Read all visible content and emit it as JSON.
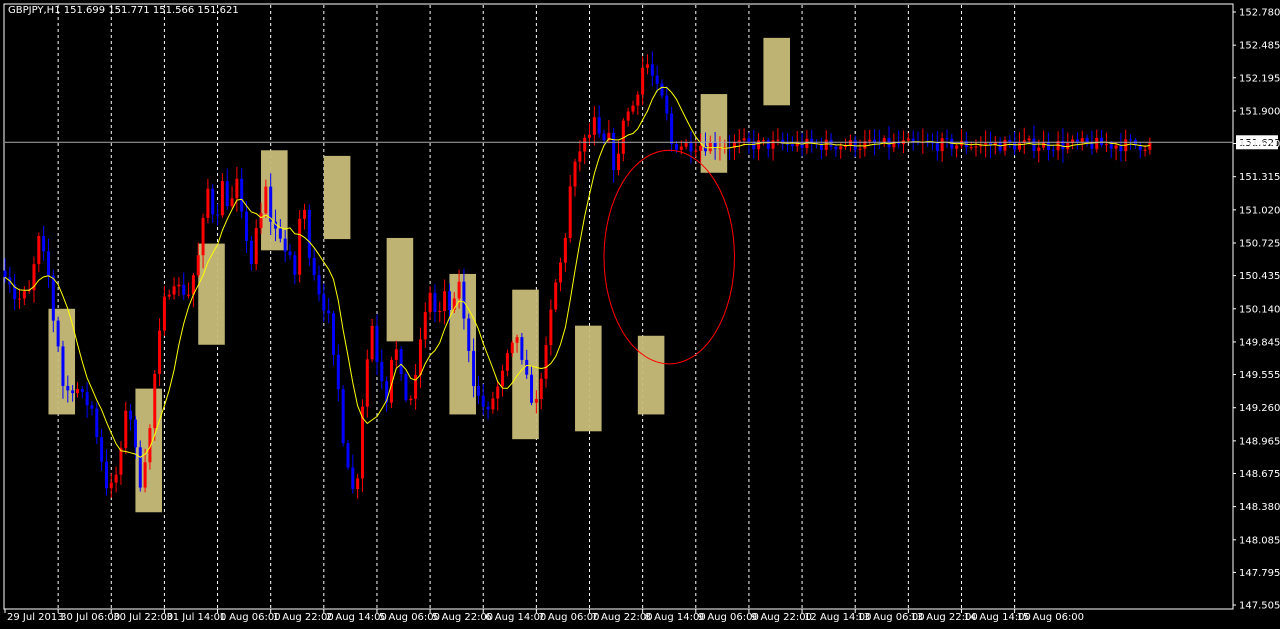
{
  "header": {
    "symbol": "GBPJPY,H1",
    "open": "151.699",
    "high": "151.771",
    "low": "151.566",
    "close": "151.621"
  },
  "colors": {
    "background": "#000000",
    "bull": "#ff0000",
    "bear": "#0000ff",
    "ma": "#ffff00",
    "box": "#c8bd78",
    "grid": "#ffffff",
    "circle": "#ff0000",
    "priceline": "#aaaaaa"
  },
  "chart_data": {
    "type": "candlestick",
    "ylim": [
      147.505,
      152.78
    ],
    "x_range": [
      0,
      508
    ],
    "y_ticks": [
      "152.780",
      "152.485",
      "152.195",
      "151.900",
      "151.610",
      "151.315",
      "151.020",
      "150.725",
      "150.435",
      "150.140",
      "149.845",
      "149.555",
      "149.260",
      "148.965",
      "148.675",
      "148.380",
      "148.085",
      "147.795",
      "147.505"
    ],
    "x_ticks": [
      {
        "label": "29 Jul 2013",
        "x": 0
      },
      {
        "label": "30 Jul 06:00",
        "x": 22
      },
      {
        "label": "30 Jul 22:00",
        "x": 44
      },
      {
        "label": "31 Jul 14:00",
        "x": 66
      },
      {
        "label": "1 Aug 06:00",
        "x": 88
      },
      {
        "label": "1 Aug 22:00",
        "x": 110
      },
      {
        "label": "2 Aug 14:00",
        "x": 132
      },
      {
        "label": "5 Aug 06:00",
        "x": 154
      },
      {
        "label": "5 Aug 22:00",
        "x": 176
      },
      {
        "label": "6 Aug 14:00",
        "x": 198
      },
      {
        "label": "7 Aug 06:00",
        "x": 220
      },
      {
        "label": "7 Aug 22:00",
        "x": 242
      },
      {
        "label": "8 Aug 14:00",
        "x": 264
      },
      {
        "label": "9 Aug 06:00",
        "x": 286
      },
      {
        "label": "9 Aug 22:00",
        "x": 308
      },
      {
        "label": "12 Aug 14:00",
        "x": 330
      },
      {
        "label": "13 Aug 06:00",
        "x": 352
      },
      {
        "label": "13 Aug 22:00",
        "x": 374
      },
      {
        "label": "14 Aug 14:00",
        "x": 396
      },
      {
        "label": "15 Aug 06:00",
        "x": 418
      }
    ],
    "current_price": "151.621",
    "anchors": [
      [
        0,
        150.48
      ],
      [
        5,
        150.22
      ],
      [
        10,
        150.28
      ],
      [
        14,
        150.75
      ],
      [
        17,
        150.55
      ],
      [
        20,
        150.05
      ],
      [
        25,
        149.4
      ],
      [
        29,
        149.45
      ],
      [
        32,
        149.35
      ],
      [
        36,
        149.25
      ],
      [
        40,
        148.8
      ],
      [
        43,
        148.5
      ],
      [
        45,
        148.6
      ],
      [
        48,
        148.85
      ],
      [
        51,
        149.4
      ],
      [
        53,
        148.95
      ],
      [
        56,
        148.6
      ],
      [
        59,
        148.9
      ],
      [
        62,
        149.55
      ],
      [
        64,
        149.9
      ],
      [
        67,
        150.3
      ],
      [
        70,
        150.4
      ],
      [
        73,
        150.3
      ],
      [
        76,
        150.28
      ],
      [
        80,
        150.6
      ],
      [
        84,
        151.2
      ],
      [
        87,
        150.95
      ],
      [
        90,
        151.25
      ],
      [
        93,
        151.05
      ],
      [
        96,
        151.25
      ],
      [
        99,
        150.85
      ],
      [
        102,
        150.55
      ],
      [
        105,
        150.9
      ],
      [
        108,
        151.2
      ],
      [
        111,
        150.85
      ],
      [
        114,
        150.8
      ],
      [
        117,
        150.6
      ],
      [
        120,
        150.45
      ],
      [
        123,
        151.1
      ],
      [
        126,
        150.65
      ],
      [
        130,
        150.3
      ],
      [
        134,
        150.05
      ],
      [
        137,
        149.55
      ],
      [
        140,
        149.0
      ],
      [
        143,
        148.7
      ],
      [
        145,
        148.35
      ],
      [
        147,
        149.0
      ],
      [
        149,
        149.6
      ],
      [
        152,
        150.0
      ],
      [
        155,
        149.6
      ],
      [
        158,
        149.35
      ],
      [
        161,
        149.85
      ],
      [
        164,
        149.5
      ],
      [
        167,
        149.3
      ],
      [
        170,
        149.5
      ],
      [
        173,
        150.0
      ],
      [
        176,
        150.3
      ],
      [
        179,
        150.05
      ],
      [
        182,
        150.25
      ],
      [
        185,
        150.1
      ],
      [
        188,
        150.4
      ],
      [
        191,
        149.9
      ],
      [
        194,
        149.5
      ],
      [
        197,
        149.3
      ],
      [
        200,
        149.2
      ],
      [
        203,
        149.4
      ],
      [
        206,
        149.55
      ],
      [
        209,
        149.75
      ],
      [
        212,
        149.9
      ],
      [
        215,
        149.55
      ],
      [
        218,
        149.35
      ],
      [
        220,
        149.3
      ],
      [
        223,
        149.65
      ],
      [
        226,
        150.1
      ],
      [
        229,
        150.45
      ],
      [
        232,
        150.8
      ],
      [
        235,
        151.35
      ],
      [
        238,
        151.55
      ],
      [
        241,
        151.65
      ],
      [
        244,
        151.8
      ],
      [
        247,
        151.6
      ],
      [
        250,
        151.65
      ],
      [
        253,
        151.35
      ],
      [
        256,
        151.85
      ],
      [
        259,
        151.9
      ],
      [
        262,
        152.1
      ],
      [
        265,
        152.35
      ],
      [
        268,
        152.2
      ],
      [
        271,
        152.05
      ],
      [
        274,
        151.85
      ],
      [
        276,
        151.6
      ]
    ],
    "boxes": [
      {
        "x1": 18,
        "x2": 29,
        "top": 150.14,
        "bot": 149.2
      },
      {
        "x1": 54,
        "x2": 65,
        "top": 149.43,
        "bot": 148.33
      },
      {
        "x1": 80,
        "x2": 91,
        "top": 150.72,
        "bot": 149.82
      },
      {
        "x1": 106,
        "x2": 117,
        "top": 151.55,
        "bot": 150.66
      },
      {
        "x1": 132,
        "x2": 143,
        "top": 151.5,
        "bot": 150.76
      },
      {
        "x1": 158,
        "x2": 169,
        "top": 150.77,
        "bot": 149.85
      },
      {
        "x1": 184,
        "x2": 195,
        "top": 150.45,
        "bot": 149.2
      },
      {
        "x1": 210,
        "x2": 221,
        "top": 150.31,
        "bot": 148.98
      },
      {
        "x1": 236,
        "x2": 247,
        "top": 149.99,
        "bot": 149.05
      },
      {
        "x1": 262,
        "x2": 273,
        "top": 149.9,
        "bot": 149.2
      },
      {
        "x1": 288,
        "x2": 299,
        "top": 152.05,
        "bot": 151.35
      },
      {
        "x1": 314,
        "x2": 325,
        "top": 152.55,
        "bot": 151.95
      }
    ],
    "circle": {
      "x": 275,
      "y": 150.6,
      "rx": 27,
      "ry": 0.95
    }
  }
}
